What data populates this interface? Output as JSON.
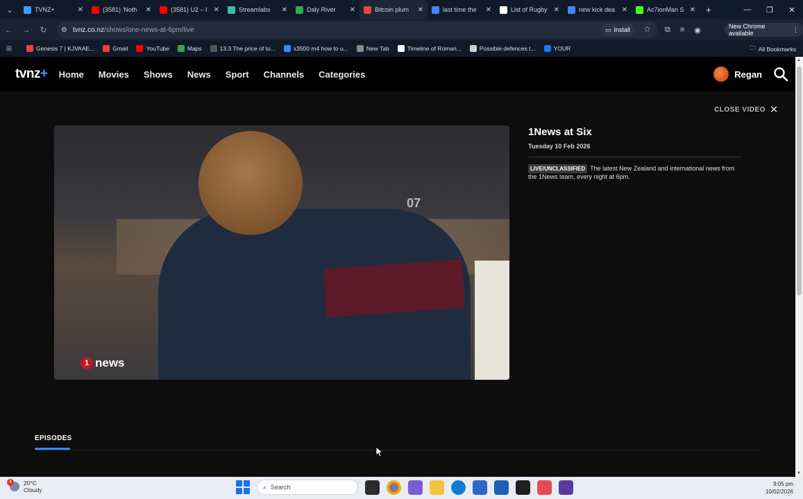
{
  "browser": {
    "tabs": [
      {
        "label": "TVNZ+",
        "color": "#3aa0ff",
        "active": false
      },
      {
        "label": "(3581) 'Noth",
        "color": "#ff0000",
        "active": false
      },
      {
        "label": "(3581) U2 – I",
        "color": "#ff0000",
        "active": false
      },
      {
        "label": "Streamlabs",
        "color": "#32c3a2",
        "active": false
      },
      {
        "label": "Daly River",
        "color": "#34a853",
        "active": false
      },
      {
        "label": "Bitcoin plum",
        "color": "#e8453c",
        "active": true
      },
      {
        "label": "last time the",
        "color": "#4285f4",
        "active": false
      },
      {
        "label": "List of Rugby",
        "color": "#ffffff",
        "active": false
      },
      {
        "label": "new kick dea",
        "color": "#4285f4",
        "active": false
      },
      {
        "label": "Ac7ionMan S",
        "color": "#53fc18",
        "active": false
      }
    ],
    "url_host": "tvnz.co.nz",
    "url_path": "/shows/one-news-at-6pm/live",
    "install_label": "Install",
    "new_chrome_label": "New Chrome available",
    "bookmarks": [
      {
        "label": "Genesis 7 | KJVAAE...",
        "color": "#e8453c"
      },
      {
        "label": "Gmail",
        "color": "#ea4335"
      },
      {
        "label": "YouTube",
        "color": "#ff0000"
      },
      {
        "label": "Maps",
        "color": "#34a853"
      },
      {
        "label": "13.3 The price of to...",
        "color": "#555555"
      },
      {
        "label": "x3500 m4 how to u...",
        "color": "#4285f4"
      },
      {
        "label": "New Tab",
        "color": "#888888"
      },
      {
        "label": "Timeline of Roman...",
        "color": "#ffffff"
      },
      {
        "label": "Possible defences t...",
        "color": "#cccccc"
      },
      {
        "label": "YOUR",
        "color": "#1877f2"
      }
    ],
    "all_bookmarks_label": "All Bookmarks"
  },
  "site": {
    "logo_text": "tvnz",
    "logo_plus": "+",
    "nav": [
      "Home",
      "Movies",
      "Shows",
      "News",
      "Sport",
      "Channels",
      "Categories"
    ],
    "user_name": "Regan",
    "close_video_label": "CLOSE VIDEO",
    "player_watermark": "news",
    "player_watermark_num": "1",
    "jersey_number": "07",
    "show": {
      "title": "1News at Six",
      "date": "Tuesday 10 Feb 2026",
      "badge": "LIVE/UNCLASSIFIED",
      "description": "The latest New Zealand and international news from the 1News team, every night at 6pm."
    },
    "episodes_tab": "EPISODES"
  },
  "taskbar": {
    "weather_temp": "20°C",
    "weather_desc": "Cloudy",
    "weather_badge": "4",
    "search_placeholder": "Search",
    "time": "9:05 pm",
    "date": "10/02/2026"
  }
}
